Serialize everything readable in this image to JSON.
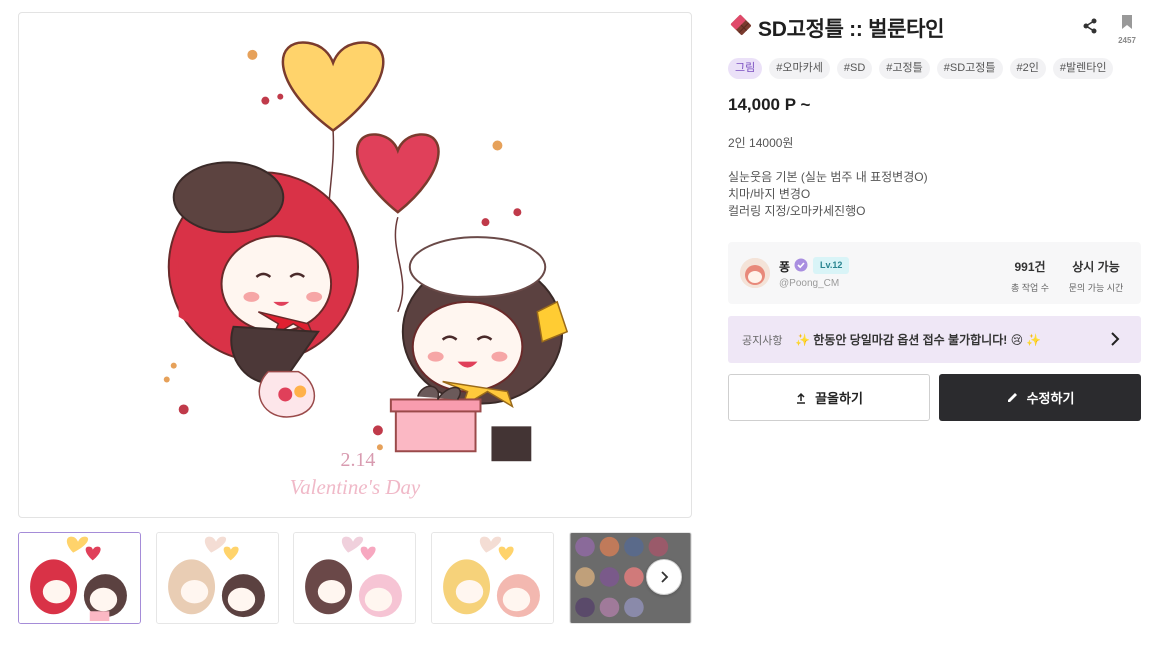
{
  "product": {
    "title": "SD고정틀 :: 벌룬타인",
    "title_icon": "chocolate-bar-icon",
    "bookmark_count": "2457",
    "tags": [
      "그림",
      "#오마카세",
      "#SD",
      "#고정틀",
      "#SD고정틀",
      "#2인",
      "#발렌타인"
    ],
    "price": "14,000 P ~",
    "description": [
      "2인 14000원",
      "",
      "실눈웃음 기본 (실눈 범주 내 표정변경O)",
      "치마/바지 변경O",
      "컬러링 지정/오마카세진행O"
    ]
  },
  "image": {
    "caption_date": "2.14",
    "caption_text": "Valentine's Day"
  },
  "seller": {
    "name": "퐁",
    "level": "Lv.12",
    "handle": "@Poong_CM",
    "stats": [
      {
        "value": "991건",
        "label": "총 작업 수"
      },
      {
        "value": "상시 가능",
        "label": "문의 가능 시간"
      }
    ]
  },
  "notice": {
    "label": "공지사항",
    "text": "✨ 한동안 당일마감 옵션 접수 불가합니다! 😢 ✨"
  },
  "buttons": {
    "pull_label": "끌올하기",
    "edit_label": "수정하기"
  },
  "colors": {
    "accent_purple": "#7a4fc0",
    "notice_bg": "#efe7f6",
    "level_bg": "#d9f4f7",
    "dark_button": "#2b2b2e",
    "heart_yellow": "#ffd36b",
    "heart_red": "#e0405a"
  }
}
